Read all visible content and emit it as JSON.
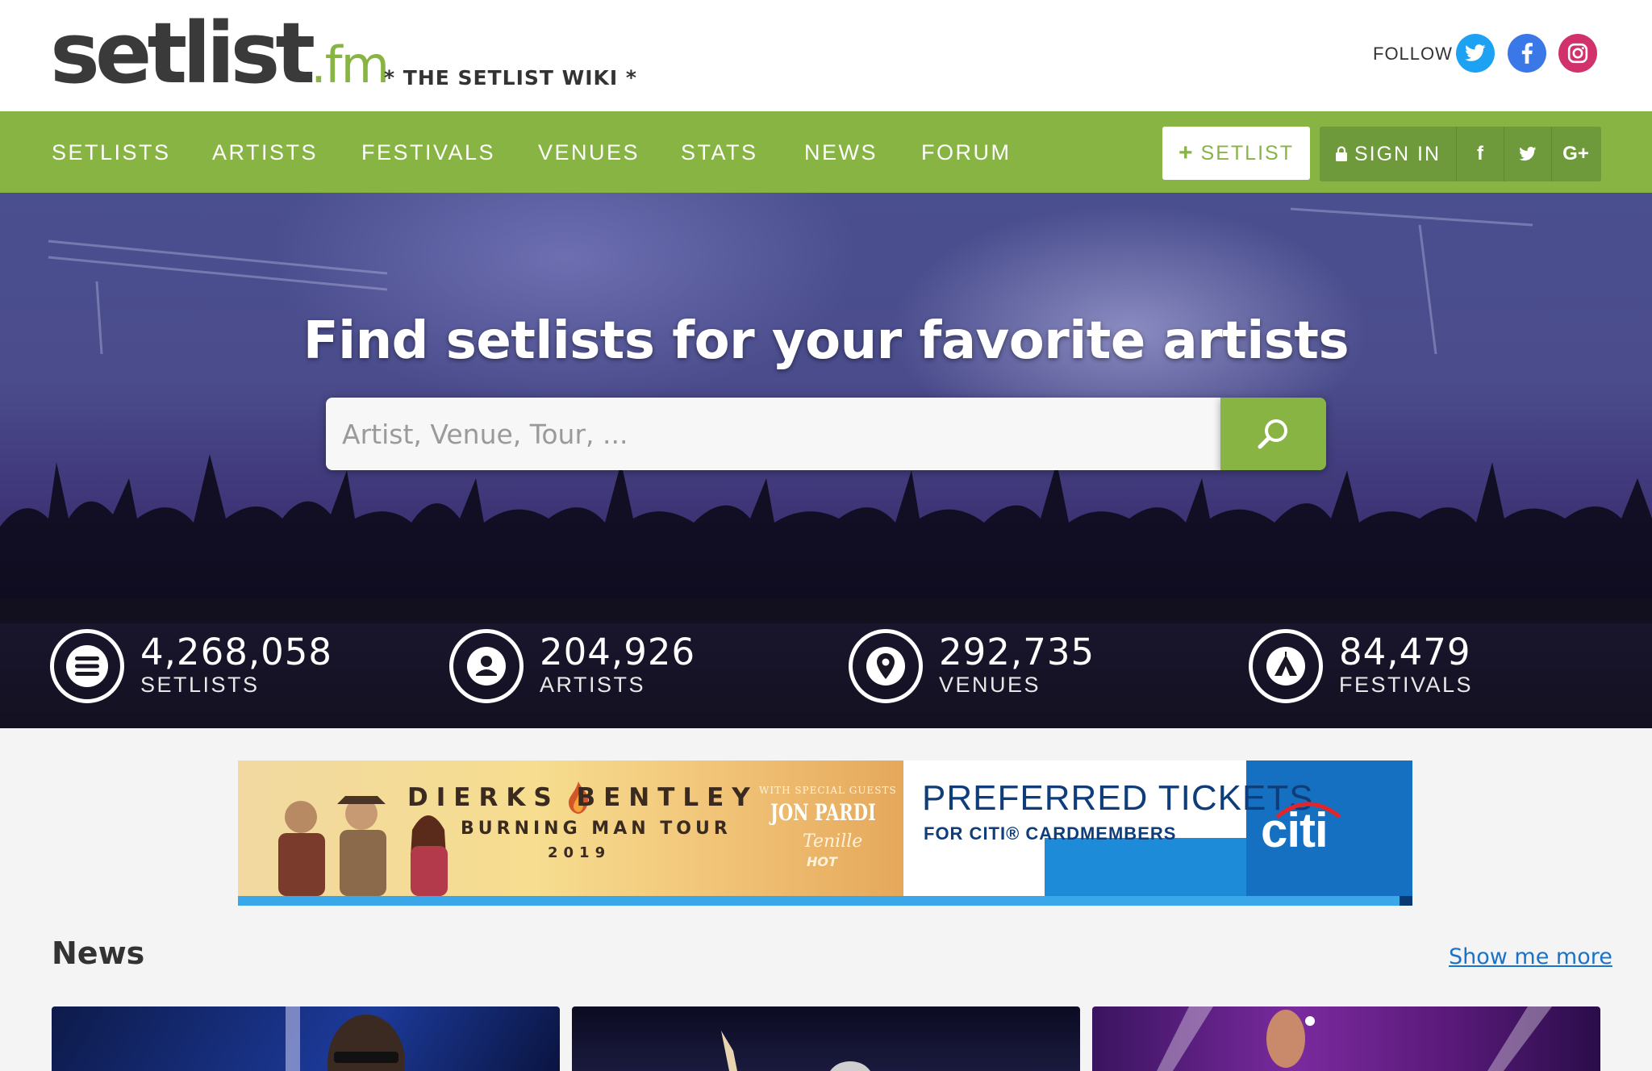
{
  "brand": {
    "logo_main": "setlist",
    "logo_ext": ".fm",
    "tagline": "* THE SETLIST WIKI *"
  },
  "follow": {
    "label": "FOLLOW",
    "icons": [
      "twitter-icon",
      "facebook-icon",
      "instagram-icon"
    ]
  },
  "nav": {
    "items": [
      "SETLISTS",
      "ARTISTS",
      "FESTIVALS",
      "VENUES",
      "STATS",
      "NEWS",
      "FORUM"
    ],
    "add_setlist_label": "SETLIST",
    "sign_in_label": "SIGN IN",
    "auth_icons": [
      "f",
      "t",
      "G+"
    ]
  },
  "hero": {
    "title": "Find setlists for your favorite artists",
    "search_placeholder": "Artist, Venue, Tour, ..."
  },
  "stats": [
    {
      "value": "4,268,058",
      "label": "SETLISTS",
      "icon": "list-icon"
    },
    {
      "value": "204,926",
      "label": "ARTISTS",
      "icon": "person-icon"
    },
    {
      "value": "292,735",
      "label": "VENUES",
      "icon": "map-pin-icon"
    },
    {
      "value": "84,479",
      "label": "FESTIVALS",
      "icon": "tent-icon"
    }
  ],
  "ad": {
    "headline": "DIERKS BENTLEY",
    "tour": "BURNING MAN TOUR",
    "year": "2019",
    "guests_label": "WITH SPECIAL GUESTS",
    "guest_main": "JON PARDI",
    "guest_2": "Tenille",
    "guest_3": "HOT",
    "offer": "PREFERRED TICKETS",
    "offer_sub": "FOR CITI® CARDMEMBERS",
    "sponsor": "citi"
  },
  "news": {
    "title": "News",
    "more_link": "Show me more"
  },
  "colors": {
    "brand_green": "#88b444",
    "brand_green_dark": "#6e9a3c",
    "link_blue": "#1a73c8"
  }
}
